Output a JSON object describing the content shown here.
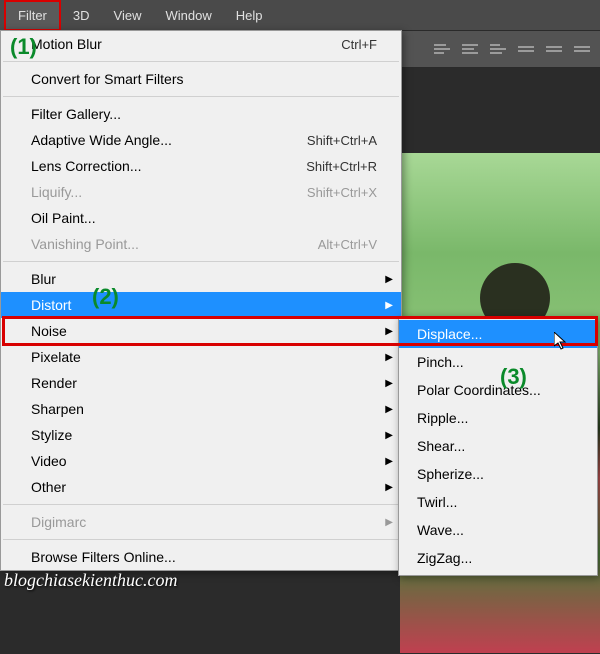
{
  "menubar": {
    "items": [
      "Filter",
      "3D",
      "View",
      "Window",
      "Help"
    ]
  },
  "dropdown": {
    "last_filter": {
      "label": "Motion Blur",
      "shortcut": "Ctrl+F"
    },
    "convert": "Convert for Smart Filters",
    "section2": [
      {
        "label": "Filter Gallery...",
        "shortcut": "",
        "disabled": false
      },
      {
        "label": "Adaptive Wide Angle...",
        "shortcut": "Shift+Ctrl+A",
        "disabled": false
      },
      {
        "label": "Lens Correction...",
        "shortcut": "Shift+Ctrl+R",
        "disabled": false
      },
      {
        "label": "Liquify...",
        "shortcut": "Shift+Ctrl+X",
        "disabled": true
      },
      {
        "label": "Oil Paint...",
        "shortcut": "",
        "disabled": false
      },
      {
        "label": "Vanishing Point...",
        "shortcut": "Alt+Ctrl+V",
        "disabled": true
      }
    ],
    "submenus": [
      "Blur",
      "Distort",
      "Noise",
      "Pixelate",
      "Render",
      "Sharpen",
      "Stylize",
      "Video",
      "Other"
    ],
    "digimarc": "Digimarc",
    "browse": "Browse Filters Online..."
  },
  "distort_submenu": {
    "items": [
      "Displace...",
      "Pinch...",
      "Polar Coordinates...",
      "Ripple...",
      "Shear...",
      "Spherize...",
      "Twirl...",
      "Wave...",
      "ZigZag..."
    ]
  },
  "annotations": {
    "a1": "(1)",
    "a2": "(2)",
    "a3": "(3)"
  },
  "watermark": "blogchiasekienthuc.com"
}
